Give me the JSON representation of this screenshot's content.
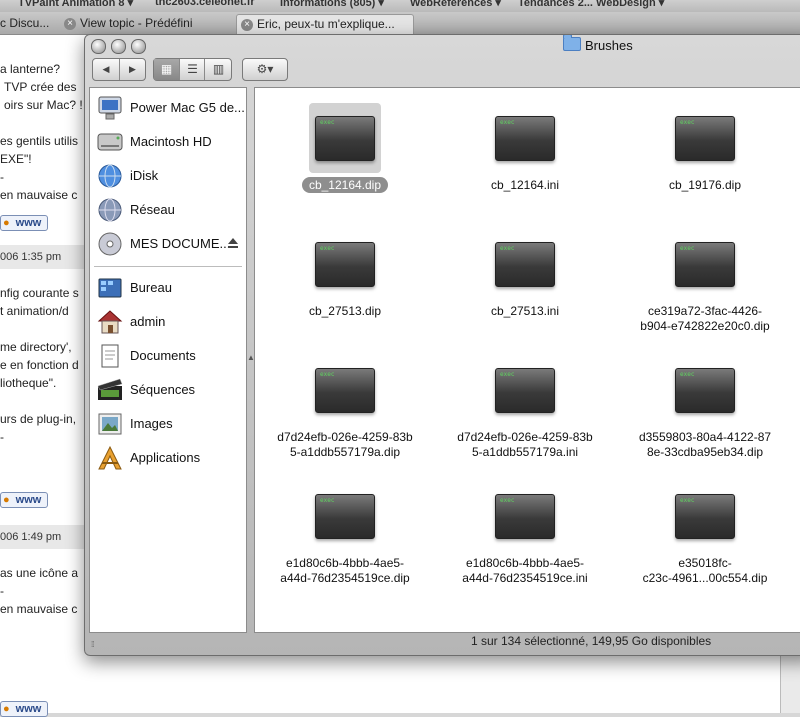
{
  "bookmarks": [
    "TVPaint Animation 8 ▾",
    "thc2603.celeonet.fr",
    "Informations (805) ▾",
    "WebReferences ▾",
    "Tendances 2... WebDesign ▾"
  ],
  "browser_tabs": [
    "c Discu...",
    "View topic - Prédéfini",
    "Eric, peux-tu m'explique..."
  ],
  "page_lines": [
    "a lanterne?",
    "TVP crée des",
    "oirs sur Mac? !",
    "es gentils utilis",
    "EXE\"!",
    "-",
    "en mauvaise c",
    "nfig courante s",
    "t animation/d",
    "me directory',",
    "e en fonction d",
    "liotheque\".",
    "urs de plug-in,",
    "-",
    "as une icône a",
    "-",
    "en mauvaise c"
  ],
  "page_dates": [
    "006 1:35 pm",
    "006 1:49 pm"
  ],
  "www_label": "www",
  "finder": {
    "title": "Brushes",
    "nav_back": "◀",
    "nav_forward": "▶",
    "view_icons": [
      "▦",
      "☰",
      "▥"
    ],
    "action_icon": "⚙▾",
    "sidebar": [
      {
        "label": "Power Mac G5 de...",
        "icon": "computer-icon"
      },
      {
        "label": "Macintosh HD",
        "icon": "hard-disk-icon"
      },
      {
        "label": "iDisk",
        "icon": "idisk-icon"
      },
      {
        "label": "Réseau",
        "icon": "network-icon"
      },
      {
        "label": "MES DOCUME...",
        "icon": "disc-icon"
      },
      {
        "label": "Bureau",
        "icon": "desktop-icon"
      },
      {
        "label": "admin",
        "icon": "home-icon"
      },
      {
        "label": "Documents",
        "icon": "documents-icon"
      },
      {
        "label": "Séquences",
        "icon": "movies-icon"
      },
      {
        "label": "Images",
        "icon": "pictures-icon"
      },
      {
        "label": "Applications",
        "icon": "applications-icon"
      }
    ],
    "files": [
      {
        "name": "cb_12164.dip",
        "selected": true
      },
      {
        "name": "cb_12164.ini"
      },
      {
        "name": "cb_19176.dip"
      },
      {
        "name": "cb_27513.dip"
      },
      {
        "name": "cb_27513.ini"
      },
      {
        "name": "ce319a72-3fac-4426-\nb904-e742822e20c0.dip"
      },
      {
        "name": "d7d24efb-026e-4259-83b\n5-a1ddb557179a.dip"
      },
      {
        "name": "d7d24efb-026e-4259-83b\n5-a1ddb557179a.ini"
      },
      {
        "name": "d3559803-80a4-4122-87\n8e-33cdba95eb34.dip"
      },
      {
        "name": "e1d80c6b-4bbb-4ae5-\na44d-76d2354519ce.dip"
      },
      {
        "name": "e1d80c6b-4bbb-4ae5-\na44d-76d2354519ce.ini"
      },
      {
        "name": "e35018fc-\nc23c-4961...00c554.dip"
      }
    ],
    "file_icon_text": "exec",
    "status": "1 sur 134 sélectionné, 149,95 Go disponibles"
  }
}
